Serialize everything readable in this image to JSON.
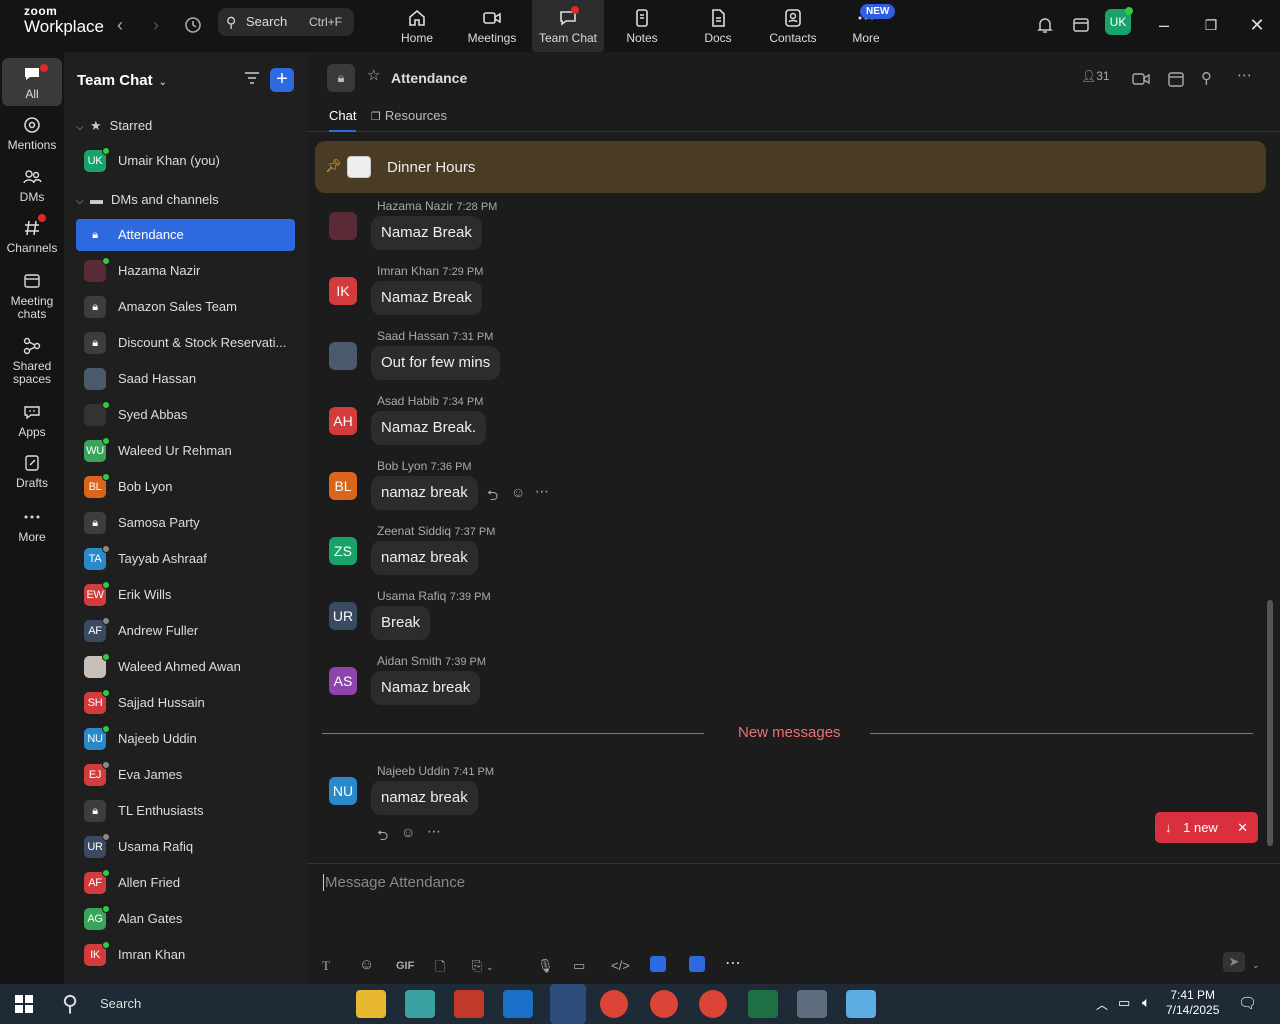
{
  "topbar": {
    "logo_line1": "zoom",
    "logo_line2": "Workplace",
    "search_label": "Search",
    "search_shortcut": "Ctrl+F",
    "new_badge": "NEW",
    "avatar_initials": "UK",
    "tabs": [
      {
        "label": "Home",
        "icon": "home-icon"
      },
      {
        "label": "Meetings",
        "icon": "video-icon"
      },
      {
        "label": "Team Chat",
        "icon": "chat-icon"
      },
      {
        "label": "Notes",
        "icon": "notes-icon"
      },
      {
        "label": "Docs",
        "icon": "docs-icon"
      },
      {
        "label": "Contacts",
        "icon": "contacts-icon"
      },
      {
        "label": "More",
        "icon": "more-icon"
      }
    ]
  },
  "rail": {
    "items": [
      {
        "label": "All",
        "icon": "chat-bubble-icon"
      },
      {
        "label": "Mentions",
        "icon": "at-icon"
      },
      {
        "label": "DMs",
        "icon": "people-icon"
      },
      {
        "label": "Channels",
        "icon": "hash-icon"
      },
      {
        "label_line1": "Meeting",
        "label_line2": "chats",
        "icon": "calendar-chat-icon"
      },
      {
        "label_line1": "Shared",
        "label_line2": "spaces",
        "icon": "share-icon"
      },
      {
        "label": "Apps",
        "icon": "apps-icon"
      },
      {
        "label": "Drafts",
        "icon": "drafts-icon"
      },
      {
        "label": "More",
        "icon": "ellipsis-icon"
      }
    ]
  },
  "sidebar": {
    "title": "Team Chat",
    "starred_label": "Starred",
    "starred_item": {
      "initials": "UK",
      "name": "Umair Khan (you)"
    },
    "dms_label": "DMs and channels",
    "items": [
      {
        "initials": "",
        "name": "Attendance",
        "locked": true
      },
      {
        "initials": "",
        "name": "Hazama Nazir"
      },
      {
        "initials": "",
        "name": "Amazon Sales Team",
        "locked": true
      },
      {
        "initials": "",
        "name": "Discount & Stock Reservati...",
        "locked": true
      },
      {
        "initials": "",
        "name": "Saad Hassan"
      },
      {
        "initials": "",
        "name": "Syed Abbas"
      },
      {
        "initials": "WU",
        "name": "Waleed Ur Rehman"
      },
      {
        "initials": "BL",
        "name": "Bob Lyon"
      },
      {
        "initials": "",
        "name": "Samosa Party",
        "locked": true
      },
      {
        "initials": "TA",
        "name": "Tayyab Ashraaf"
      },
      {
        "initials": "EW",
        "name": "Erik Wills"
      },
      {
        "initials": "AF",
        "name": "Andrew Fuller"
      },
      {
        "initials": "",
        "name": "Waleed Ahmed Awan"
      },
      {
        "initials": "SH",
        "name": "Sajjad Hussain"
      },
      {
        "initials": "NU",
        "name": "Najeeb Uddin"
      },
      {
        "initials": "EJ",
        "name": "Eva James"
      },
      {
        "initials": "",
        "name": "TL Enthusiasts",
        "locked": true
      },
      {
        "initials": "UR",
        "name": "Usama Rafiq"
      },
      {
        "initials": "AF",
        "name": "Allen Fried"
      },
      {
        "initials": "AG",
        "name": "Alan Gates"
      },
      {
        "initials": "IK",
        "name": "Imran Khan"
      }
    ]
  },
  "channel": {
    "name": "Attendance",
    "member_count": "31",
    "tabs": [
      "Chat",
      "Resources"
    ],
    "pinned": "Dinner Hours",
    "messages": [
      {
        "sender": "Hazama Nazir",
        "time": "7:28 PM",
        "initials": "",
        "text": "Namaz Break"
      },
      {
        "sender": "Imran Khan",
        "time": "7:29 PM",
        "initials": "IK",
        "text": "Namaz Break"
      },
      {
        "sender": "Saad Hassan",
        "time": "7:31 PM",
        "initials": "",
        "text": "Out for few mins"
      },
      {
        "sender": "Asad Habib",
        "time": "7:34 PM",
        "initials": "AH",
        "text": "Namaz Break."
      },
      {
        "sender": "Bob Lyon",
        "time": "7:36 PM",
        "initials": "BL",
        "text": "namaz break"
      },
      {
        "sender": "Zeenat Siddiq",
        "time": "7:37 PM",
        "initials": "ZS",
        "text": "namaz break"
      },
      {
        "sender": "Usama Rafiq",
        "time": "7:39 PM",
        "initials": "UR",
        "text": "Break"
      },
      {
        "sender": "Aidan Smith",
        "time": "7:39 PM",
        "initials": "AS",
        "text": "Namaz break"
      },
      {
        "sender": "Najeeb Uddin",
        "time": "7:41 PM",
        "initials": "NU",
        "text": "namaz break"
      }
    ],
    "new_messages_label": "New messages",
    "new_pill": "1 new",
    "composer_placeholder": "Message Attendance",
    "gif_label": "GIF"
  },
  "taskbar": {
    "search_label": "Search",
    "time": "7:41 PM",
    "date": "7/14/2025"
  },
  "colors": {
    "accent": "#2d6ae0",
    "alert": "#d92f3e",
    "pinned_bg": "#4a3b24",
    "online": "#2ecc40"
  }
}
